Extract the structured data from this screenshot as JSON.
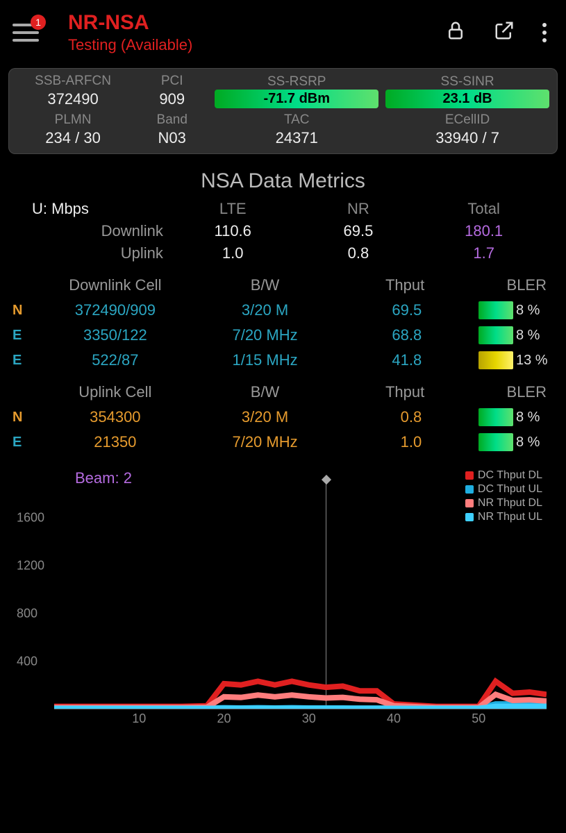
{
  "header": {
    "badge": "1",
    "title": "NR-NSA",
    "subtitle": "Testing (Available)"
  },
  "info_card": {
    "row1": {
      "ssb_arfcn": {
        "label": "SSB-ARFCN",
        "value": "372490"
      },
      "pci": {
        "label": "PCI",
        "value": "909"
      },
      "ss_rsrp": {
        "label": "SS-RSRP",
        "value": "-71.7 dBm"
      },
      "ss_sinr": {
        "label": "SS-SINR",
        "value": "23.1 dB"
      }
    },
    "row2": {
      "plmn": {
        "label": "PLMN",
        "value": "234 / 30"
      },
      "band": {
        "label": "Band",
        "value": "N03"
      },
      "tac": {
        "label": "TAC",
        "value": "24371"
      },
      "ecellid": {
        "label": "ECellID",
        "value": "33940 / 7"
      }
    }
  },
  "section_title": "NSA Data Metrics",
  "metrics": {
    "unit": "U: Mbps",
    "cols": {
      "lte": "LTE",
      "nr": "NR",
      "total": "Total"
    },
    "downlink": {
      "label": "Downlink",
      "lte": "110.6",
      "nr": "69.5",
      "total": "180.1"
    },
    "uplink": {
      "label": "Uplink",
      "lte": "1.0",
      "nr": "0.8",
      "total": "1.7"
    }
  },
  "dl_table": {
    "head": {
      "cell": "Downlink Cell",
      "bw": "B/W",
      "thput": "Thput",
      "bler": "BLER"
    },
    "rows": [
      {
        "tag": "N",
        "cell": "372490/909",
        "bw": "3/20 M",
        "thput": "69.5",
        "bler": "8 %",
        "warn": false
      },
      {
        "tag": "E",
        "cell": "3350/122",
        "bw": "7/20 MHz",
        "thput": "68.8",
        "bler": "8 %",
        "warn": false
      },
      {
        "tag": "E",
        "cell": "522/87",
        "bw": "1/15 MHz",
        "thput": "41.8",
        "bler": "13 %",
        "warn": true
      }
    ]
  },
  "ul_table": {
    "head": {
      "cell": "Uplink Cell",
      "bw": "B/W",
      "thput": "Thput",
      "bler": "BLER"
    },
    "rows": [
      {
        "tag": "N",
        "cell": "354300",
        "bw": "3/20 M",
        "thput": "0.8",
        "bler": "8 %",
        "warn": false
      },
      {
        "tag": "E",
        "cell": "21350",
        "bw": "7/20 MHz",
        "thput": "1.0",
        "bler": "8 %",
        "warn": false
      }
    ]
  },
  "chart": {
    "beam_label": "Beam: 2",
    "legend": [
      {
        "name": "DC Thput DL",
        "color": "#e02020"
      },
      {
        "name": "DC Thput UL",
        "color": "#1faee0"
      },
      {
        "name": "NR Thput DL",
        "color": "#ff7d7d"
      },
      {
        "name": "NR Thput UL",
        "color": "#3fd0ff"
      }
    ],
    "yticks": [
      "1600",
      "1200",
      "800",
      "400"
    ],
    "xticks": [
      "10",
      "20",
      "30",
      "40",
      "50"
    ],
    "marker_x": 32
  },
  "chart_data": {
    "type": "line",
    "title": "",
    "xlabel": "",
    "ylabel": "",
    "ylim": [
      0,
      1800
    ],
    "xlim": [
      0,
      58
    ],
    "x": [
      0,
      5,
      10,
      15,
      18,
      20,
      22,
      24,
      26,
      28,
      30,
      32,
      34,
      36,
      38,
      40,
      45,
      50,
      52,
      54,
      56,
      58
    ],
    "series": [
      {
        "name": "DC Thput DL",
        "color": "#e02020",
        "values": [
          20,
          20,
          20,
          20,
          25,
          210,
          200,
          230,
          200,
          230,
          200,
          180,
          190,
          150,
          150,
          40,
          20,
          20,
          230,
          130,
          140,
          120
        ]
      },
      {
        "name": "DC Thput UL",
        "color": "#1faee0",
        "values": [
          5,
          5,
          5,
          5,
          5,
          8,
          6,
          8,
          6,
          8,
          6,
          6,
          6,
          5,
          5,
          5,
          5,
          5,
          40,
          40,
          40,
          40
        ]
      },
      {
        "name": "NR Thput DL",
        "color": "#ff7d7d",
        "values": [
          10,
          10,
          10,
          10,
          12,
          100,
          95,
          115,
          100,
          115,
          100,
          90,
          95,
          80,
          75,
          25,
          10,
          10,
          120,
          70,
          75,
          65
        ]
      },
      {
        "name": "NR Thput UL",
        "color": "#3fd0ff",
        "values": [
          3,
          3,
          3,
          3,
          3,
          4,
          3,
          4,
          3,
          4,
          3,
          3,
          3,
          3,
          3,
          3,
          3,
          3,
          20,
          20,
          20,
          20
        ]
      }
    ]
  }
}
